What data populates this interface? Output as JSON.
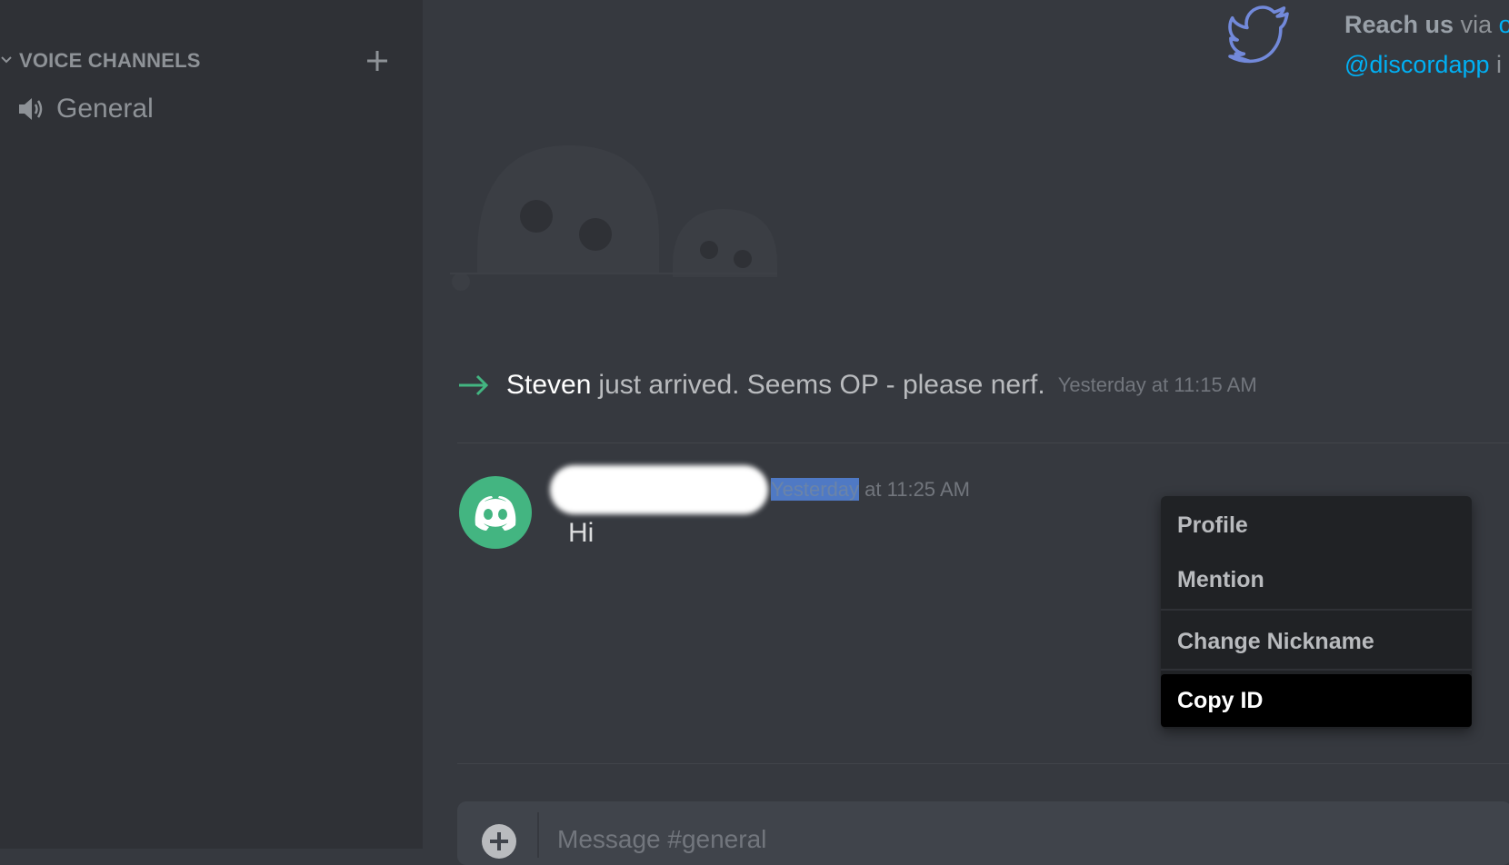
{
  "sidebar": {
    "voice_header": "VOICE CHANNELS",
    "channels": [
      {
        "name": "General",
        "icon": "speaker-icon"
      }
    ]
  },
  "header": {
    "reach_strong": "Reach us",
    "reach_rest": " via ",
    "reach_link_partial": "o",
    "twitter_handle": "@discordapp",
    "handle_trailing": " i"
  },
  "system_message": {
    "username": "Steven",
    "text": "just arrived. Seems OP - please nerf.",
    "timestamp": "Yesterday at 11:15 AM"
  },
  "message": {
    "timestamp_selected": "Yesterday",
    "timestamp_rest": " at 11:25 AM",
    "text": "Hi"
  },
  "context_menu": {
    "items": [
      {
        "label": "Profile"
      },
      {
        "label": "Mention"
      },
      {
        "label": "Change Nickname"
      },
      {
        "label": "Copy ID",
        "highlighted": true
      }
    ]
  },
  "composer": {
    "placeholder": "Message #general"
  },
  "colors": {
    "sidebar_bg": "#2f3136",
    "main_bg": "#36393f",
    "avatar_green": "#43b581",
    "link_blue": "#00b0f4",
    "twitter_purple": "#7289da",
    "menu_bg": "#202225",
    "menu_highlight": "#000000"
  }
}
